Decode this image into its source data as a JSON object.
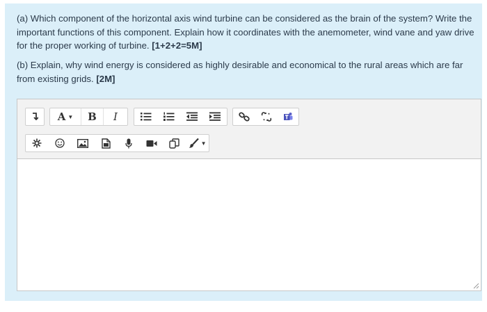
{
  "question": {
    "part_a_text": "(a) Which component of the horizontal axis wind turbine can be considered as the brain of the system? Write the important functions of this component. Explain how it coordinates with the anemometer, wind vane and yaw drive for the proper working of turbine. ",
    "part_a_marks": "[1+2+2=5M]",
    "part_b_text": "(b) Explain, why wind energy is considered as highly desirable and economical to the rural areas which are far from existing grids. ",
    "part_b_marks": "[2M]"
  },
  "toolbar": {
    "row1": {
      "toggle": {
        "icon": "expand-toolbar-icon"
      },
      "font_color": {
        "label": "A",
        "icon": "caret-down-icon"
      },
      "bold": {
        "label": "B"
      },
      "italic": {
        "label": "I"
      },
      "lists": [
        "unordered-list-icon",
        "ordered-list-icon",
        "outdent-icon",
        "indent-icon"
      ],
      "links": [
        "link-icon",
        "unlink-icon",
        "teams-icon"
      ]
    },
    "row2": {
      "icons": [
        "special-character-icon",
        "emoji-icon",
        "image-icon",
        "media-icon",
        "microphone-icon",
        "video-icon",
        "copy-icon",
        "paint-brush-icon"
      ]
    }
  },
  "editor": {
    "content": ""
  },
  "colors": {
    "panel_bg": "#dbeff9",
    "toolbar_bg": "#f2f2f2",
    "text": "#2b3a4a",
    "teams_purple": "#5b5fc7"
  }
}
